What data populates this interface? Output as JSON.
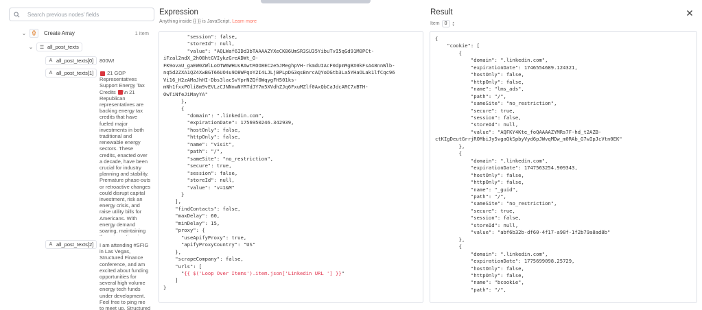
{
  "search": {
    "placeholder": "Search previous nodes' fields"
  },
  "tree": {
    "node": {
      "label": "Create Array",
      "count": "1 item"
    },
    "array_field": "all_post_texts",
    "fields": [
      {
        "key": "all_post_texts[0]",
        "value": "800W!"
      },
      {
        "key": "all_post_texts[1]",
        "value": "21 GOP Representatives Support Energy Tax Credits ",
        "value_tail": "\\n 21 Republican representatives are backing energy tax credits that have fueled major investments in both traditional and renewable energy sectors. These credits, enacted over a decade, have been crucial for industry planning and stability. Premature phase-outs or retroactive changes could disrupt capital investment, risk an energy crisis, and raise utility bills for Americans. With energy demand soaring, maintaining these incentives is key to keeping energy prices low and supporting domestic manufacturing and job creation— especially in pro..."
      },
      {
        "key": "all_post_texts[2]",
        "value": "I am attending #SFIG in Las Vegas, Structured Finance conference, and am excited about funding opportunities for several high volume energy tech funds under development. Feel free to ping me to meet up. Structured Finance Association"
      }
    ]
  },
  "expression": {
    "title": "Expression",
    "hint_prefix": "Anything inside",
    "hint_braces": "{{ }}",
    "hint_mid": "is JavaScript.",
    "hint_link": "Learn more",
    "lines_before": [
      "        \"session\": false,",
      "        \"storeId\": null,",
      "        \"value\": \"AQLWaf6IDd3bTAAAAZYXeCK86UmSR3SU35YibuTvI5qGd91M0PCt-",
      "iFzal2ndX_2h08htGVIykzGreADWt_O-",
      "FK9ovaU_gaEW0ZWlLoOTW6WHUsRAwtROO8EC2e5JMeghpVH-rkmdUIAcF0dpmMgBX0kFsA48nnWlb-",
      "nq5d2ZXA1QZ4XwBGT66UO4u9D8WPqoY2I4LJLjBPLpDG3qsBnrcAQYoDGtb3La5YHaOLak1lfCqc96",
      "Vi16_H2zAMaJhHI-Dbs3lacSvYprNZQf0WqygFH501ks-",
      "mNh1fxxPOli8m9vEVLzCJNNnwNYRTdJY7m5XVdhZJq6FxuMZlf0AxQbCaJdcARC7xBTH-",
      "OwTiNfeJiMayYA\"",
      "      },",
      "      {",
      "        \"domain\": \".linkedin.com\",",
      "        \"expirationDate\": 1756950246.342939,",
      "        \"hostOnly\": false,",
      "        \"httpOnly\": false,",
      "        \"name\": \"visit\",",
      "        \"path\": \"/\",",
      "        \"sameSite\": \"no_restriction\",",
      "        \"secure\": true,",
      "        \"session\": false,",
      "        \"storeId\": null,",
      "        \"value\": \"v=1&M\"",
      "      }",
      "    ],",
      "    \"findContacts\": false,",
      "    \"maxDelay\": 60,",
      "    \"minDelay\": 15,",
      "    \"proxy\": {",
      "      \"useApifyProxy\": true,",
      "      \"apifyProxyCountry\": \"US\"",
      "    },",
      "    \"scrapeCompany\": false,",
      "    \"urls\": ["
    ],
    "expr_indent": "      \"",
    "expr_line": "{{ $('Loop Over Items').item.json['Linkedin URL '] }}",
    "expr_close": "\"",
    "lines_after": [
      "    ]",
      "}"
    ]
  },
  "result": {
    "title": "Result",
    "item_label": "Item",
    "item_index": "0",
    "lines": [
      "{",
      "    \"cookie\": [",
      "        {",
      "            \"domain\": \".linkedin.com\",",
      "            \"expirationDate\": 1746554689.124321,",
      "            \"hostOnly\": false,",
      "            \"httpOnly\": false,",
      "            \"name\": \"lms_ads\",",
      "            \"path\": \"/\",",
      "            \"sameSite\": \"no_restriction\",",
      "            \"secure\": true,",
      "            \"session\": false,",
      "            \"storeId\": null,",
      "            \"value\": \"AQFKY4Kte_foQAAAAZYMRs7F-hd_t2AZB-",
      "ctKIgDeutGrrjROMbiJy5vgaQkSpbyVyd6pJWvqMDw_m0RAb_G7wIpJcVtn0EK\"",
      "        },",
      "        {",
      "            \"domain\": \".linkedin.com\",",
      "            \"expirationDate\": 1747563254.909343,",
      "            \"hostOnly\": false,",
      "            \"httpOnly\": false,",
      "            \"name\": \"_guid\",",
      "            \"path\": \"/\",",
      "            \"sameSite\": \"no_restriction\",",
      "            \"secure\": true,",
      "            \"session\": false,",
      "            \"storeId\": null,",
      "            \"value\": \"abf6b32b-df60-4f17-a98f-1f2b79a8ad8b\"",
      "        },",
      "        {",
      "            \"domain\": \".linkedin.com\",",
      "            \"expirationDate\": 1775699098.25729,",
      "            \"hostOnly\": false,",
      "            \"httpOnly\": false,",
      "            \"name\": \"bcookie\",",
      "            \"path\": \"/\","
    ]
  }
}
